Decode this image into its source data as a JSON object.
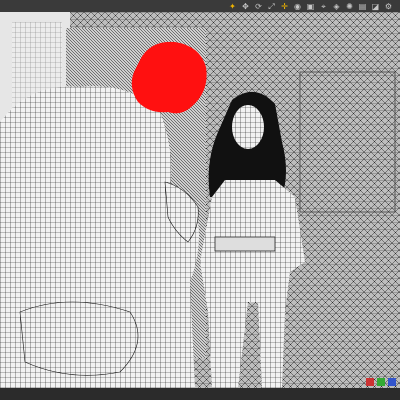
{
  "toolbar": {
    "tools": [
      {
        "icon": "select-icon",
        "glyph": "✦",
        "active": true
      },
      {
        "icon": "move-icon",
        "glyph": "✥",
        "active": false
      },
      {
        "icon": "rotate-icon",
        "glyph": "⟳",
        "active": false
      },
      {
        "icon": "scale-icon",
        "glyph": "⤢",
        "active": false
      },
      {
        "icon": "universal-tool-icon",
        "glyph": "✛",
        "active": true
      },
      {
        "icon": "node-weight-icon",
        "glyph": "◉",
        "active": false
      },
      {
        "icon": "surface-selection-icon",
        "glyph": "▣",
        "active": false
      },
      {
        "icon": "joint-editor-icon",
        "glyph": "⌖",
        "active": false
      },
      {
        "icon": "camera-icon",
        "glyph": "◈",
        "active": false
      },
      {
        "icon": "light-icon",
        "glyph": "✺",
        "active": false
      },
      {
        "icon": "render-icon",
        "glyph": "▤",
        "active": false
      },
      {
        "icon": "perspective-icon",
        "glyph": "◪",
        "active": false
      },
      {
        "icon": "settings-icon",
        "glyph": "⚙",
        "active": false
      }
    ]
  },
  "viewport": {
    "render_mode": "wireframe",
    "colors": {
      "highlight": "#ff1010",
      "wire": "#1a1a1a",
      "surface": "#f2f2f2",
      "background": "#9a9a9a"
    }
  },
  "corner_widgets": [
    {
      "icon": "axis-x-icon",
      "color": "#cc3333"
    },
    {
      "icon": "axis-y-icon",
      "color": "#33aa33"
    },
    {
      "icon": "axis-z-icon",
      "color": "#3355cc"
    }
  ]
}
